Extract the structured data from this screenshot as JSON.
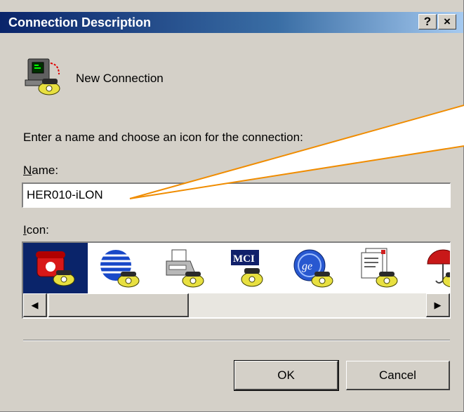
{
  "window": {
    "title": "Connection Description",
    "help_label": "?",
    "close_label": "×"
  },
  "header": {
    "connection_name": "New Connection"
  },
  "form": {
    "prompt": "Enter a name and choose an icon for the connection:",
    "name_label_hotkey": "N",
    "name_label_rest": "ame:",
    "name_value": "HER010-iLON",
    "icon_label_hotkey": "I",
    "icon_label_rest": "con:"
  },
  "icons": [
    {
      "name": "red-phone-icon",
      "selected": true
    },
    {
      "name": "globe-icon",
      "selected": false
    },
    {
      "name": "fax-icon",
      "selected": false
    },
    {
      "name": "mci-icon",
      "selected": false
    },
    {
      "name": "ge-icon",
      "selected": false
    },
    {
      "name": "documents-icon",
      "selected": false
    },
    {
      "name": "umbrella-icon",
      "selected": false
    }
  ],
  "buttons": {
    "ok": "OK",
    "cancel": "Cancel"
  },
  "colors": {
    "titlebar": "#0a246a",
    "selection": "#0a246a",
    "dialog": "#d4d0c8",
    "callout": "#f08c00"
  }
}
